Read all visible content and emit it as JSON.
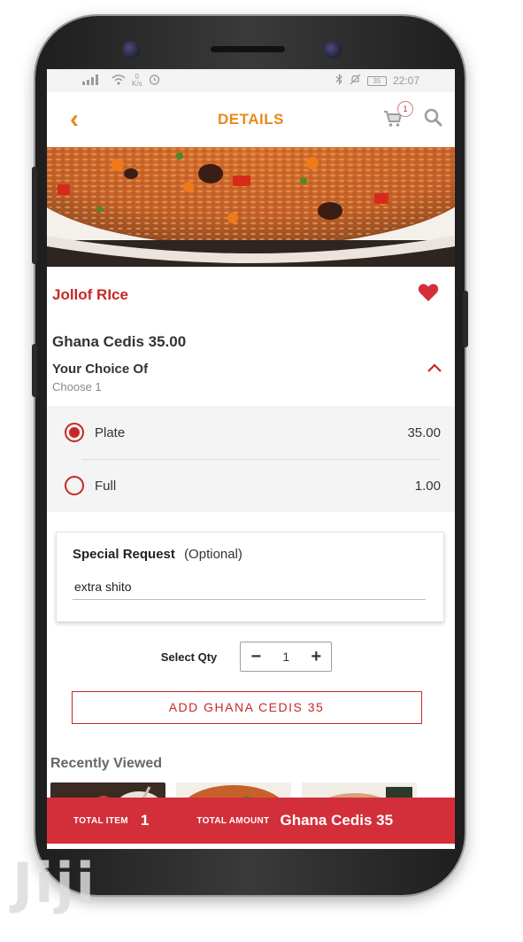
{
  "status_bar": {
    "speed_value": "0",
    "speed_unit": "K/s",
    "battery": "35",
    "time": "22:07"
  },
  "header": {
    "title": "DETAILS",
    "cart_count": "1"
  },
  "item": {
    "name": "Jollof RIce",
    "price": "Ghana Cedis 35.00"
  },
  "choice": {
    "title": "Your Choice Of",
    "subtitle": "Choose 1",
    "options": [
      {
        "label": "Plate",
        "price": "35.00",
        "selected": true
      },
      {
        "label": "Full",
        "price": "1.00",
        "selected": false
      }
    ]
  },
  "special_request": {
    "title": "Special Request",
    "optional": "(Optional)",
    "value": "extra shito"
  },
  "quantity": {
    "label": "Select Qty",
    "value": "1",
    "minus": "−",
    "plus": "+"
  },
  "add_button": {
    "label": "ADD GHANA CEDIS 35"
  },
  "recently_viewed": {
    "title": "Recently Viewed"
  },
  "footer": {
    "total_item_label": "TOTAL ITEM",
    "total_item_value": "1",
    "total_amount_label": "TOTAL AMOUNT",
    "total_amount_value": "Ghana Cedis 35"
  },
  "watermark": "Jiji",
  "colors": {
    "accent_orange": "#e88a1a",
    "accent_red": "#c62828",
    "footer_red": "#d32f3a"
  }
}
